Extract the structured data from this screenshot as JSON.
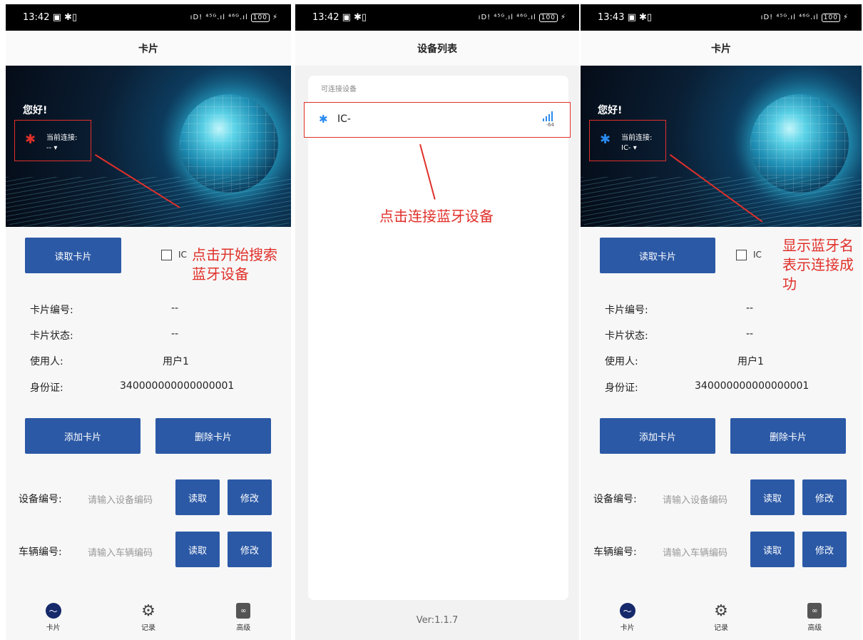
{
  "status": {
    "p1_time": "13:42",
    "p2_time": "13:42",
    "p3_time": "13:43",
    "icons": "▣ ✱▯",
    "signals": "ıD! ⁴⁵ᴳ.ıl ⁴⁶ᴳ.ıl",
    "battery": "100",
    "charging": "⚡"
  },
  "card_screen": {
    "title": "卡片",
    "hello": "您好!",
    "conn_label": "当前连接:",
    "conn_value_p1": "-- ▾",
    "conn_value_p3": "IC- ▾",
    "read_card": "读取卡片",
    "ic_label": "IC",
    "labels": {
      "card_no": "卡片编号:",
      "card_status": "卡片状态:",
      "user": "使用人:",
      "id_card": "身份证:"
    },
    "values": {
      "card_no": "--",
      "card_status": "--",
      "user": "用户1",
      "id_card": "340000000000000001"
    },
    "add_card": "添加卡片",
    "delete_card": "删除卡片",
    "device_no_label": "设备编号:",
    "device_no_placeholder": "请输入设备编码",
    "vehicle_no_label": "车辆编号:",
    "vehicle_no_placeholder": "请输入车辆编码",
    "read": "读取",
    "modify": "修改",
    "tabs": [
      "卡片",
      "记录",
      "高级"
    ]
  },
  "device_screen": {
    "title": "设备列表",
    "section": "可连接设备",
    "device_name": "IC-",
    "rssi": "-64",
    "version": "Ver:1.1.7"
  },
  "annotations": {
    "p1": [
      "点击开始搜索",
      "蓝牙设备"
    ],
    "p2": "点击连接蓝牙设备",
    "p3": [
      "显示蓝牙名",
      "表示连接成",
      "功"
    ]
  },
  "colors": {
    "primary_button": "#2b59a6",
    "annotation_red": "#e0302a",
    "bluetooth_blue": "#2a8bf0"
  }
}
